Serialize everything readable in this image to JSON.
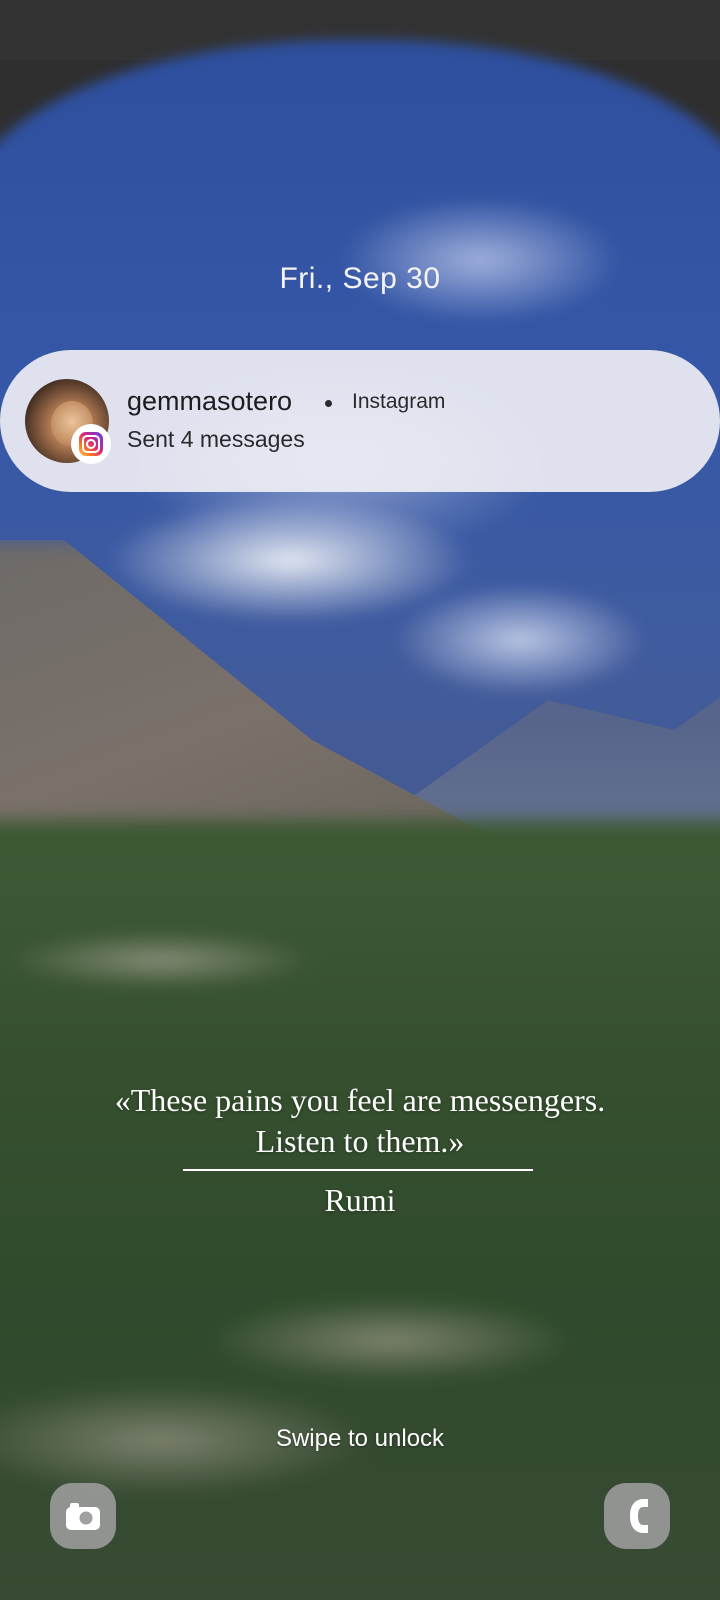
{
  "lockscreen": {
    "date": "Fri., Sep 30",
    "swipe_hint": "Swipe to unlock"
  },
  "notification": {
    "sender": "gemmasotero",
    "app_name": "Instagram",
    "message": "Sent 4 messages",
    "app_icon": "instagram-icon",
    "avatar": "contact-avatar"
  },
  "quote": {
    "line1": "«These pains you feel are messengers.",
    "line2": "Listen to them.»",
    "author": "Rumi"
  },
  "shortcuts": {
    "left_icon": "camera-icon",
    "right_icon": "phone-icon"
  }
}
